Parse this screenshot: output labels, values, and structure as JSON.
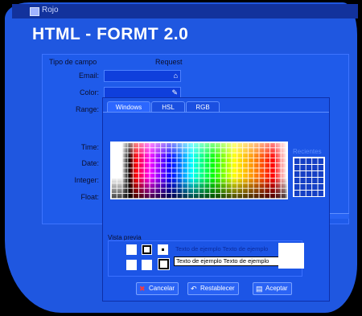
{
  "window": {
    "title": "Rojo"
  },
  "app": {
    "header": "HTML - FORMT 2.0"
  },
  "form": {
    "col_field_type": "Tipo de campo",
    "col_required": "Request",
    "labels": {
      "email": "Email:",
      "color": "Color:",
      "range": "Range:",
      "time": "Time:",
      "date": "Date:",
      "integer": "Integer:",
      "float": "Float:"
    },
    "color_value": "",
    "icons": {
      "email": "home-icon",
      "color": "palette-icon"
    }
  },
  "picker": {
    "tabs": [
      "Windows",
      "HSL",
      "RGB"
    ],
    "active_tab": 0,
    "recent_label": "Recientes",
    "preview_label": "Vista previa",
    "sample_text_1": "Texto de ejemplo  Texto de ejemplo",
    "sample_text_2": "Texto de ejemplo  Texto de ejemplo",
    "buttons": {
      "cancel": "Cancelar",
      "reset": "Restablecer",
      "accept": "Aceptar"
    },
    "colors": {
      "dialog_bg": "#1c55e6",
      "cancel_icon": "#ff3a3a"
    }
  }
}
